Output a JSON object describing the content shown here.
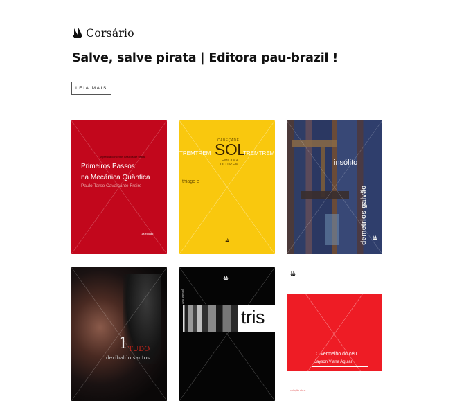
{
  "site": {
    "name": "Corsário",
    "logo_icon": "pirate-ship-icon"
  },
  "post": {
    "title": "Salve, salve pirata | Editora pau-brazil !",
    "read_more": "LEIA MAIS"
  },
  "books": [
    {
      "pretitle": "Aprenda conceitos básicos de física",
      "title_line1": "Primeiros Passos",
      "title_line2": "na Mecânica Quântica",
      "author": "Paulo Tarso Cavalcante Freire",
      "edition": "1a edição",
      "colors": {
        "background": "#c2071c"
      }
    },
    {
      "top": "CABEÇADE",
      "left_word": "TREMTREM",
      "sol": "SOL",
      "right_word": "TREMTREM",
      "bottom1": "EMCIMA",
      "bottom2": "DOTREM",
      "author": "thiago e",
      "colors": {
        "background": "#f9c80e"
      }
    },
    {
      "title": "insólito",
      "author": "demetrios galvão",
      "colors": {
        "background": "#3b4a6b"
      }
    },
    {
      "number": "1",
      "title_rest": "TUDO",
      "author": "deribaldo santos",
      "colors": {
        "background": "#0c0a0a"
      }
    },
    {
      "spine": "janaina mar",
      "title": "tris",
      "colors": {
        "background": "#050505"
      }
    },
    {
      "title": "O vermelho do céu",
      "author": "Jayson Viana Aguiar",
      "collection": "coleção ebus",
      "colors": {
        "background": "#ffffff",
        "panel": "#ee1c25"
      }
    }
  ]
}
